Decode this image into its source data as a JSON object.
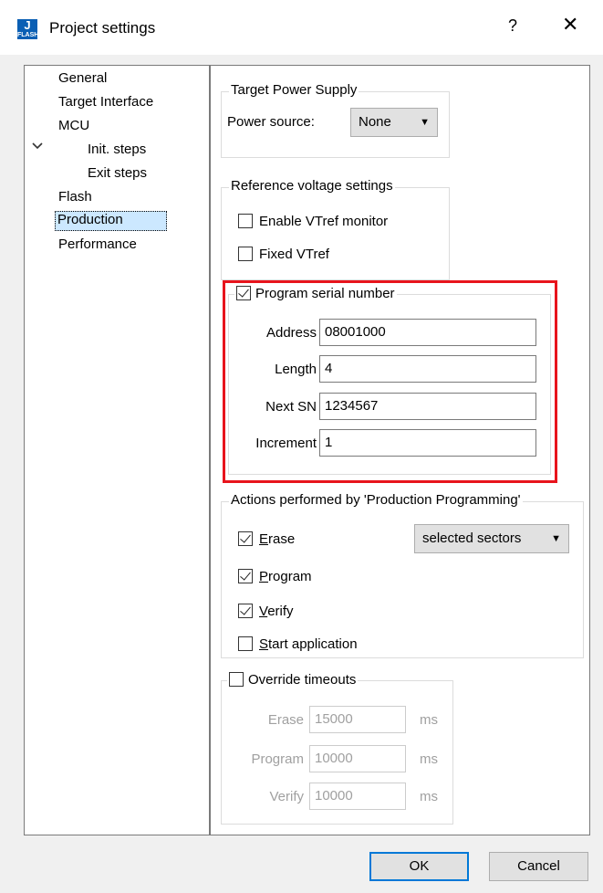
{
  "window": {
    "title": "Project settings",
    "help": "?",
    "close": "✕",
    "icon_top": "J",
    "icon_bottom": "FLASH"
  },
  "tree": {
    "items": [
      "General",
      "Target Interface",
      "MCU",
      "Init. steps",
      "Exit steps",
      "Flash",
      "Production",
      "Performance"
    ],
    "expanded_chevron": "⌄"
  },
  "power": {
    "group_title": "Target Power Supply",
    "label": "Power source:",
    "value": "None"
  },
  "vref": {
    "group_title": "Reference voltage settings",
    "enable_monitor": "Enable VTref monitor",
    "fixed": "Fixed VTref"
  },
  "serial": {
    "checkbox_label": "Program serial number",
    "address_label": "Address",
    "address_value": "08001000",
    "length_label": "Length",
    "length_value": "4",
    "next_label": "Next SN",
    "next_value": "1234567",
    "increment_label": "Increment",
    "increment_value": "1"
  },
  "actions": {
    "group_title": "Actions performed by 'Production Programming'",
    "erase_pre": "",
    "erase_u": "E",
    "erase_rest": "rase",
    "erase_mode": "selected sectors",
    "program_u": "P",
    "program_rest": "rogram",
    "verify_u": "V",
    "verify_rest": "erify",
    "start_u": "S",
    "start_rest": "tart application"
  },
  "timeouts": {
    "checkbox_label": "Override timeouts",
    "erase_label": "Erase",
    "erase_value": "15000",
    "program_label": "Program",
    "program_value": "10000",
    "verify_label": "Verify",
    "verify_value": "10000",
    "unit": "ms"
  },
  "buttons": {
    "ok": "OK",
    "cancel": "Cancel"
  },
  "colors": {
    "highlight": "#e8141c",
    "selection": "#cce8ff",
    "accent": "#0078d7"
  }
}
